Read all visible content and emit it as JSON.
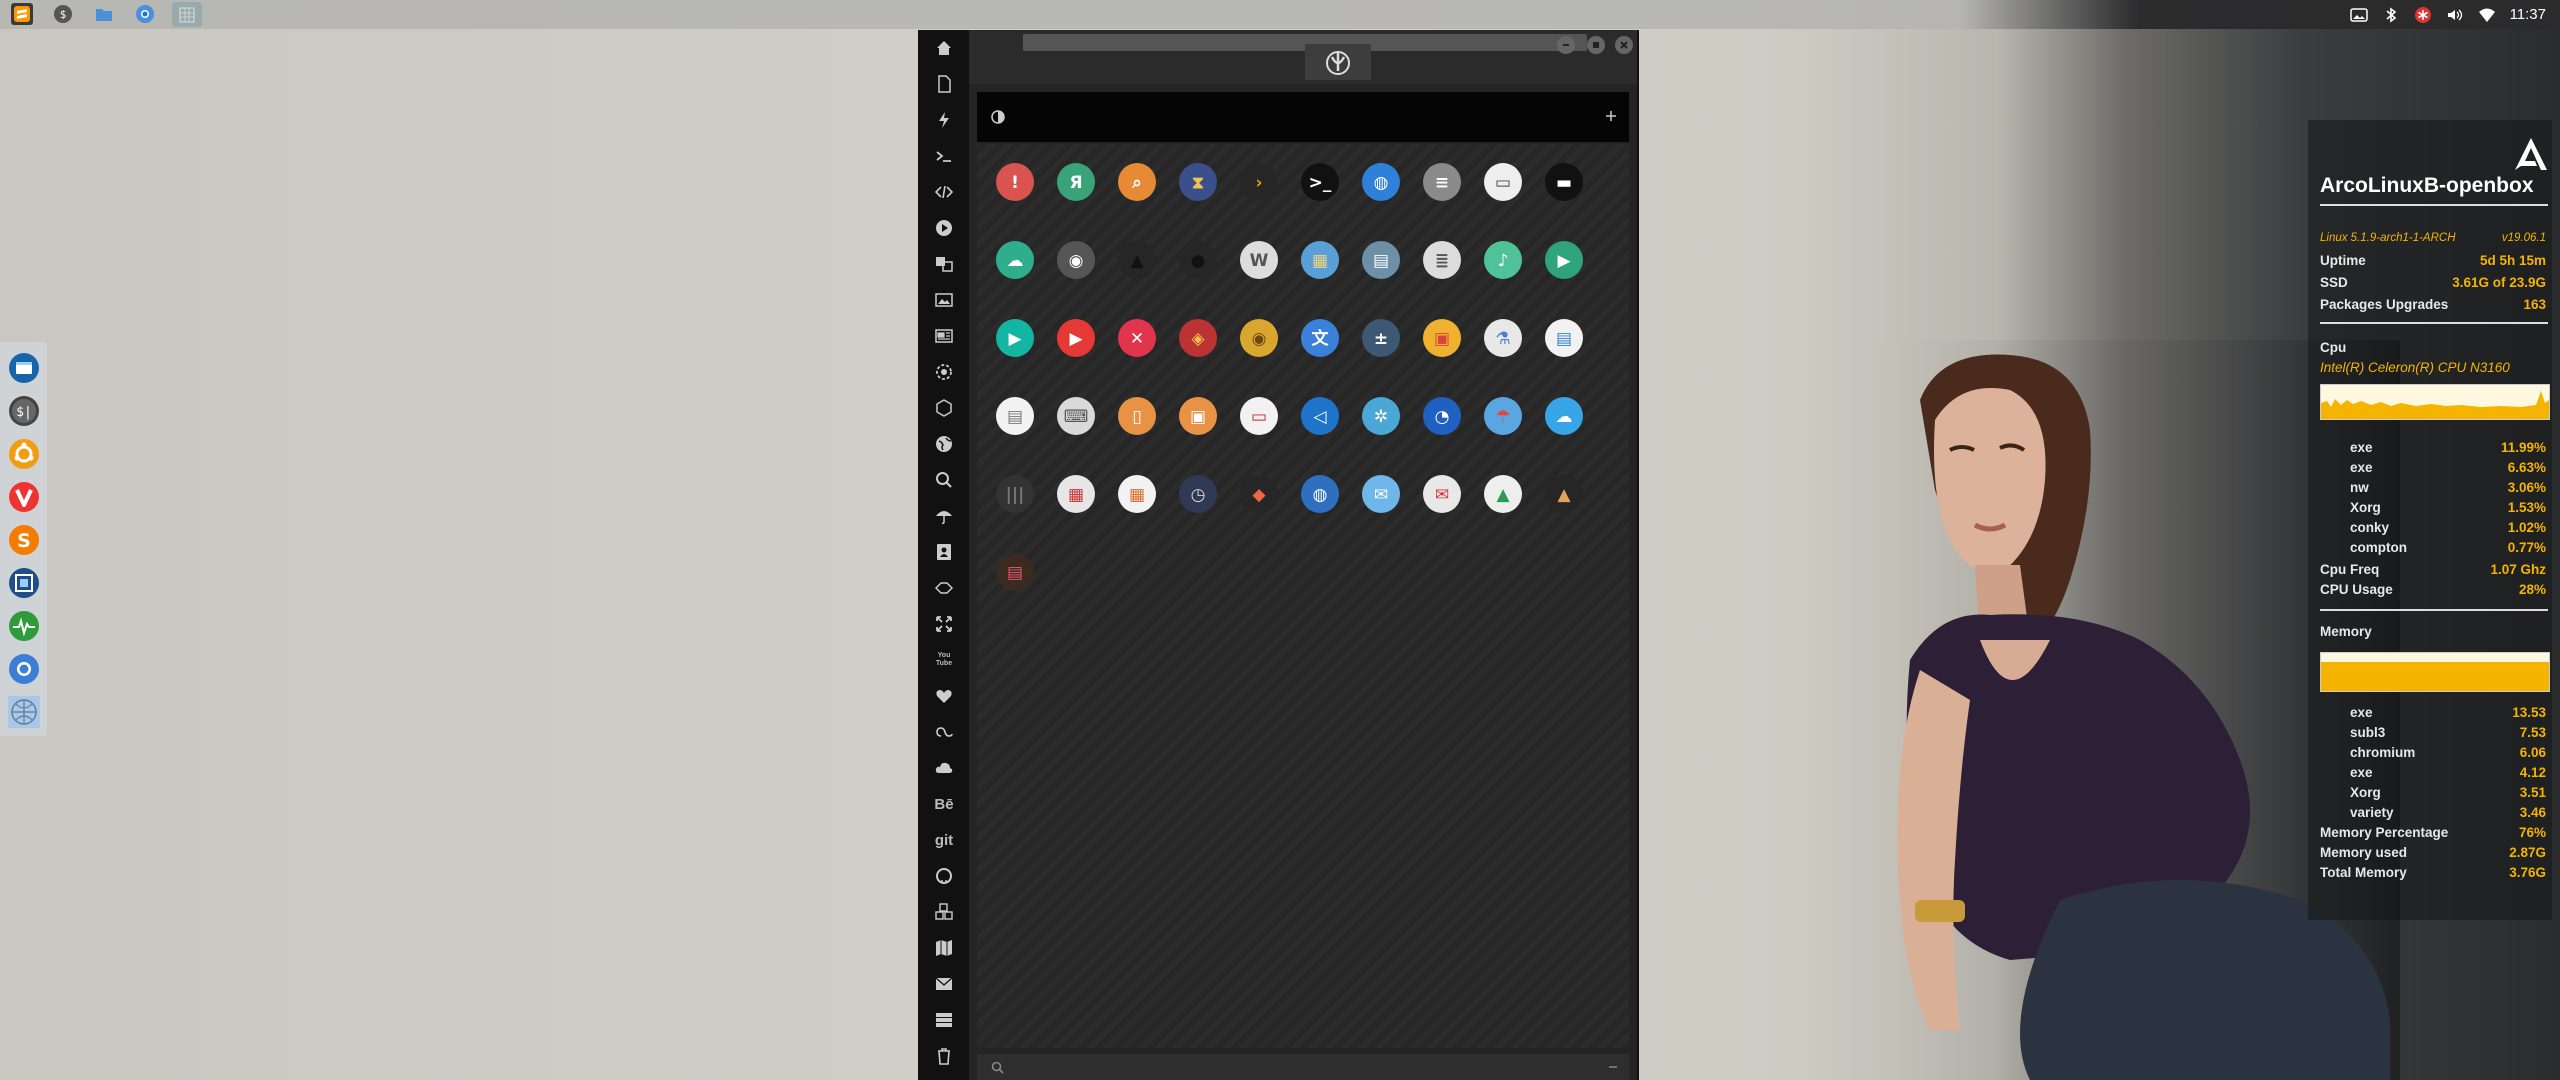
{
  "topbar": {
    "apps": [
      "sublime-text-icon",
      "dollar-terminal-icon",
      "file-manager-icon",
      "chromium-icon",
      "workspace-icon"
    ],
    "clock": "11:37",
    "tray": [
      "image-icon",
      "bluetooth-icon",
      "asterisk-icon",
      "volume-icon",
      "wifi-icon"
    ]
  },
  "dock": {
    "items": [
      "file-manager-icon",
      "terminal-icon",
      "ubuntu-icon",
      "vivaldi-icon",
      "sublime-icon",
      "screenshot-icon",
      "system-monitor-icon",
      "chromium-icon",
      "network-icon"
    ]
  },
  "window": {
    "sidebar_icons": [
      "home-icon",
      "document-icon",
      "bolt-icon",
      "terminal-icon",
      "code-icon",
      "play-icon",
      "translate-icon",
      "image-icon",
      "news-icon",
      "settings-icon",
      "hexagon-icon",
      "globe-icon",
      "search-icon",
      "umbrella-icon",
      "contact-icon",
      "tag-icon",
      "expand-icon",
      "youtube-icon",
      "heart-icon",
      "lastfm-icon",
      "cloud-icon",
      "behance-icon",
      "git-icon",
      "github-icon",
      "cubes-icon",
      "map-icon",
      "mail-icon",
      "server-icon",
      "trash-icon"
    ],
    "sidebar_text": {
      "behance": "Bē",
      "git": "git",
      "youtube": "You Tube"
    },
    "apps": [
      [
        "warning-app",
        "yandex-app",
        "search-app",
        "hourglass-app",
        "plex-app",
        "terminal-app",
        "browser-app",
        "disks-app",
        "window-app",
        "cash-app"
      ],
      [
        "vpn-app",
        "github-app",
        "startrek-app",
        "deathstar-app",
        "wikipedia-app",
        "maps-app",
        "archive-app",
        "notes-app",
        "music-app",
        "video-app"
      ],
      [
        "play-app",
        "youtube-app",
        "close-app",
        "ironman-app",
        "c3po-app",
        "translate-app",
        "calculator-app",
        "photos-app",
        "lab-app",
        "sheet-app"
      ],
      [
        "text-app",
        "keyboard-app",
        "document-app",
        "image-app",
        "presentation-app",
        "vscode-app",
        "spider-app",
        "cpu-app",
        "umbrella-app",
        "weather-app"
      ],
      [
        "equalizer-app",
        "calendar-app",
        "planner-app",
        "clock-app",
        "diamond-app",
        "globe-app",
        "mail-app",
        "gmail-app",
        "drive-app",
        "pyramid-app"
      ],
      [
        "radio-app"
      ]
    ]
  },
  "conky": {
    "hostname": "ArcoLinuxB-openbox",
    "kernel": "Linux 5.1.9-arch1-1-ARCH",
    "version": "v19.06.1",
    "uptime_label": "Uptime",
    "uptime": "5d 5h 15m",
    "ssd_label": "SSD",
    "ssd": "3.61G of 23.9G",
    "packages_label": "Packages Upgrades",
    "packages": "163",
    "cpu_label": "Cpu",
    "cpu_model": "Intel(R) Celeron(R) CPU  N3160",
    "cpu_procs": [
      {
        "name": "exe",
        "val": "11.99%"
      },
      {
        "name": "exe",
        "val": "6.63%"
      },
      {
        "name": "nw",
        "val": "3.06%"
      },
      {
        "name": "Xorg",
        "val": "1.53%"
      },
      {
        "name": "conky",
        "val": "1.02%"
      },
      {
        "name": "compton",
        "val": "0.77%"
      }
    ],
    "cpu_freq_label": "Cpu Freq",
    "cpu_freq": "1.07 Ghz",
    "cpu_usage_label": "CPU Usage",
    "cpu_usage": "28%",
    "memory_label": "Memory",
    "mem_procs": [
      {
        "name": "exe",
        "val": "13.53"
      },
      {
        "name": "subl3",
        "val": "7.53"
      },
      {
        "name": "chromium",
        "val": "6.06"
      },
      {
        "name": "exe",
        "val": "4.12"
      },
      {
        "name": "Xorg",
        "val": "3.51"
      },
      {
        "name": "variety",
        "val": "3.46"
      }
    ],
    "mem_pct_label": "Memory Percentage",
    "mem_pct": "76%",
    "mem_used_label": "Memory used",
    "mem_used": "2.87G",
    "mem_total_label": "Total Memory",
    "mem_total": "3.76G",
    "accent": "#f5b400"
  }
}
